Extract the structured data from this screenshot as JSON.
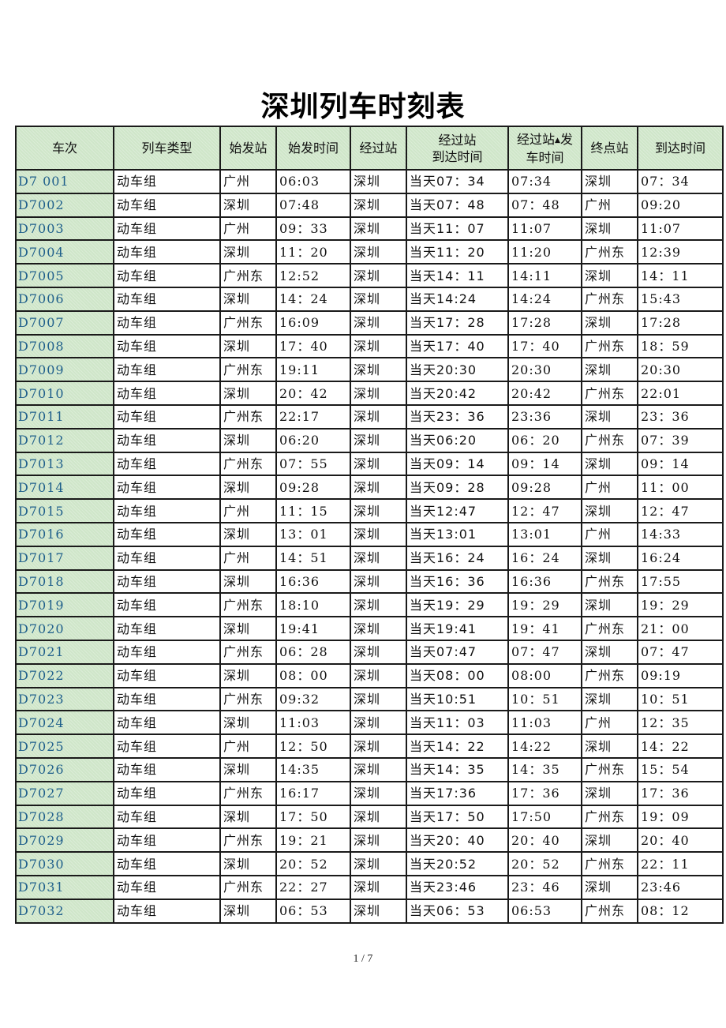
{
  "title": "深圳列车时刻表",
  "headers": {
    "train_no": "车次",
    "train_type": "列车类型",
    "origin": "始发站",
    "depart_time": "始发时间",
    "via": "经过站",
    "via_arrive_line1": "经过站",
    "via_arrive_line2": "到达时间",
    "via_depart_line1a": "经过站",
    "via_depart_mark": "▲",
    "via_depart_line1b": "发",
    "via_depart_line2": "车时间",
    "terminal": "终点站",
    "arrive_time": "到达时间"
  },
  "rows": [
    {
      "train_no": "D7 001",
      "type": "动车组",
      "origin": "广州",
      "depart": "06:03",
      "via": "深圳",
      "via_arrive": "当天07：34",
      "via_depart": "07:34",
      "terminal": "深圳",
      "arrive": "07：34"
    },
    {
      "train_no": "D7002",
      "type": "动车组",
      "origin": "深圳",
      "depart": "07:48",
      "via": "深圳",
      "via_arrive": "当天07：48",
      "via_depart": "07：48",
      "terminal": "广州",
      "arrive": "09:20"
    },
    {
      "train_no": "D7003",
      "type": "动车组",
      "origin": "广州",
      "depart": "09：33",
      "via": "深圳",
      "via_arrive": "当天11：07",
      "via_depart": "11:07",
      "terminal": "深圳",
      "arrive": "11:07"
    },
    {
      "train_no": "D7004",
      "type": "动车组",
      "origin": "深圳",
      "depart": "11：20",
      "via": "深圳",
      "via_arrive": "当天11：20",
      "via_depart": "11:20",
      "terminal": "广州东",
      "arrive": "12:39"
    },
    {
      "train_no": "D7005",
      "type": "动车组",
      "origin": "广州东",
      "depart": "12:52",
      "via": "深圳",
      "via_arrive": "当天14：11",
      "via_depart": "14:11",
      "terminal": "深圳",
      "arrive": "14：11"
    },
    {
      "train_no": "D7006",
      "type": "动车组",
      "origin": "深圳",
      "depart": "14：24",
      "via": "深圳",
      "via_arrive": "当天14:24",
      "via_depart": "14:24",
      "terminal": "广州东",
      "arrive": "15:43"
    },
    {
      "train_no": "D7007",
      "type": "动车组",
      "origin": "广州东",
      "depart": "16:09",
      "via": "深圳",
      "via_arrive": "当天17：28",
      "via_depart": "17:28",
      "terminal": "深圳",
      "arrive": "17:28"
    },
    {
      "train_no": "D7008",
      "type": "动车组",
      "origin": "深圳",
      "depart": "17：40",
      "via": "深圳",
      "via_arrive": "当天17：40",
      "via_depart": "17：40",
      "terminal": "广州东",
      "arrive": "18：59"
    },
    {
      "train_no": "D7009",
      "type": "动车组",
      "origin": "广州东",
      "depart": "19:11",
      "via": "深圳",
      "via_arrive": "当天20:30",
      "via_depart": "20:30",
      "terminal": "深圳",
      "arrive": "20:30"
    },
    {
      "train_no": "D7010",
      "type": "动车组",
      "origin": "深圳",
      "depart": "20：42",
      "via": "深圳",
      "via_arrive": "当天20:42",
      "via_depart": "20:42",
      "terminal": "广州东",
      "arrive": "22:01"
    },
    {
      "train_no": "D7011",
      "type": "动车组",
      "origin": "广州东",
      "depart": "22:17",
      "via": "深圳",
      "via_arrive": "当天23：36",
      "via_depart": "23:36",
      "terminal": "深圳",
      "arrive": "23：36"
    },
    {
      "train_no": "D7012",
      "type": "动车组",
      "origin": "深圳",
      "depart": "06:20",
      "via": "深圳",
      "via_arrive": "当天06:20",
      "via_depart": "06：20",
      "terminal": "广州东",
      "arrive": "07：39"
    },
    {
      "train_no": "D7013",
      "type": "动车组",
      "origin": "广州东",
      "depart": "07：55",
      "via": "深圳",
      "via_arrive": "当天09：14",
      "via_depart": "09：14",
      "terminal": "深圳",
      "arrive": "09：14"
    },
    {
      "train_no": "D7014",
      "type": "动车组",
      "origin": "深圳",
      "depart": "09:28",
      "via": "深圳",
      "via_arrive": "当天09：28",
      "via_depart": "09:28",
      "terminal": "广州",
      "arrive": "11：00"
    },
    {
      "train_no": "D7015",
      "type": "动车组",
      "origin": "广州",
      "depart": "11：15",
      "via": "深圳",
      "via_arrive": "当天12:47",
      "via_depart": "12：47",
      "terminal": "深圳",
      "arrive": "12：47"
    },
    {
      "train_no": "D7016",
      "type": "动车组",
      "origin": "深圳",
      "depart": "13：01",
      "via": "深圳",
      "via_arrive": "当天13:01",
      "via_depart": "13:01",
      "terminal": "广州",
      "arrive": "14:33"
    },
    {
      "train_no": "D7017",
      "type": "动车组",
      "origin": "广州",
      "depart": "14：51",
      "via": "深圳",
      "via_arrive": "当天16：24",
      "via_depart": "16：24",
      "terminal": "深圳",
      "arrive": "16:24"
    },
    {
      "train_no": "D7018",
      "type": "动车组",
      "origin": "深圳",
      "depart": "16:36",
      "via": "深圳",
      "via_arrive": "当天16：36",
      "via_depart": "16:36",
      "terminal": "广州东",
      "arrive": "17:55"
    },
    {
      "train_no": "D7019",
      "type": "动车组",
      "origin": "广州东",
      "depart": "18:10",
      "via": "深圳",
      "via_arrive": "当天19：29",
      "via_depart": "19：29",
      "terminal": "深圳",
      "arrive": "19：29"
    },
    {
      "train_no": "D7020",
      "type": "动车组",
      "origin": "深圳",
      "depart": "19:41",
      "via": "深圳",
      "via_arrive": "当天19:41",
      "via_depart": "19：41",
      "terminal": "广州东",
      "arrive": "21：00"
    },
    {
      "train_no": "D7021",
      "type": "动车组",
      "origin": "广州东",
      "depart": "06：28",
      "via": "深圳",
      "via_arrive": "当天07:47",
      "via_depart": "07：47",
      "terminal": "深圳",
      "arrive": "07：47"
    },
    {
      "train_no": "D7022",
      "type": "动车组",
      "origin": "深圳",
      "depart": "08：00",
      "via": "深圳",
      "via_arrive": "当天08：00",
      "via_depart": "08:00",
      "terminal": "广州东",
      "arrive": "09:19"
    },
    {
      "train_no": "D7023",
      "type": "动车组",
      "origin": "广州东",
      "depart": "09:32",
      "via": "深圳",
      "via_arrive": "当天10:51",
      "via_depart": "10：51",
      "terminal": "深圳",
      "arrive": "10：51"
    },
    {
      "train_no": "D7024",
      "type": "动车组",
      "origin": "深圳",
      "depart": "11:03",
      "via": "深圳",
      "via_arrive": "当天11：03",
      "via_depart": "11:03",
      "terminal": "广州",
      "arrive": "12：35"
    },
    {
      "train_no": "D7025",
      "type": "动车组",
      "origin": "广州",
      "depart": "12：50",
      "via": "深圳",
      "via_arrive": "当天14：22",
      "via_depart": "14:22",
      "terminal": "深圳",
      "arrive": "14：22"
    },
    {
      "train_no": "D7026",
      "type": "动车组",
      "origin": "深圳",
      "depart": "14:35",
      "via": "深圳",
      "via_arrive": "当天14：35",
      "via_depart": "14：35",
      "terminal": "广州东",
      "arrive": "15：54"
    },
    {
      "train_no": "D7027",
      "type": "动车组",
      "origin": "广州东",
      "depart": "16:17",
      "via": "深圳",
      "via_arrive": "当天17:36",
      "via_depart": "17：36",
      "terminal": "深圳",
      "arrive": "17：36"
    },
    {
      "train_no": "D7028",
      "type": "动车组",
      "origin": "深圳",
      "depart": "17：50",
      "via": "深圳",
      "via_arrive": "当天17：50",
      "via_depart": "17:50",
      "terminal": "广州东",
      "arrive": "19：09"
    },
    {
      "train_no": "D7029",
      "type": "动车组",
      "origin": "广州东",
      "depart": "19：21",
      "via": "深圳",
      "via_arrive": "当天20：40",
      "via_depart": "20：40",
      "terminal": "深圳",
      "arrive": "20：40"
    },
    {
      "train_no": "D7030",
      "type": "动车组",
      "origin": "深圳",
      "depart": "20：52",
      "via": "深圳",
      "via_arrive": "当天20:52",
      "via_depart": "20：52",
      "terminal": "广州东",
      "arrive": "22：11"
    },
    {
      "train_no": "D7031",
      "type": "动车组",
      "origin": "广州东",
      "depart": "22：27",
      "via": "深圳",
      "via_arrive": "当天23:46",
      "via_depart": "23：46",
      "terminal": "深圳",
      "arrive": "23:46"
    },
    {
      "train_no": "D7032",
      "type": "动车组",
      "origin": "深圳",
      "depart": "06：53",
      "via": "深圳",
      "via_arrive": "当天06：53",
      "via_depart": "06:53",
      "terminal": "广州东",
      "arrive": "08：12"
    }
  ],
  "footer": {
    "page_indicator": "1 / 7"
  },
  "colors": {
    "header_bg": "#cfe6c9",
    "train_no_text": "#1f5f8b",
    "border": "#1a1a1a"
  }
}
